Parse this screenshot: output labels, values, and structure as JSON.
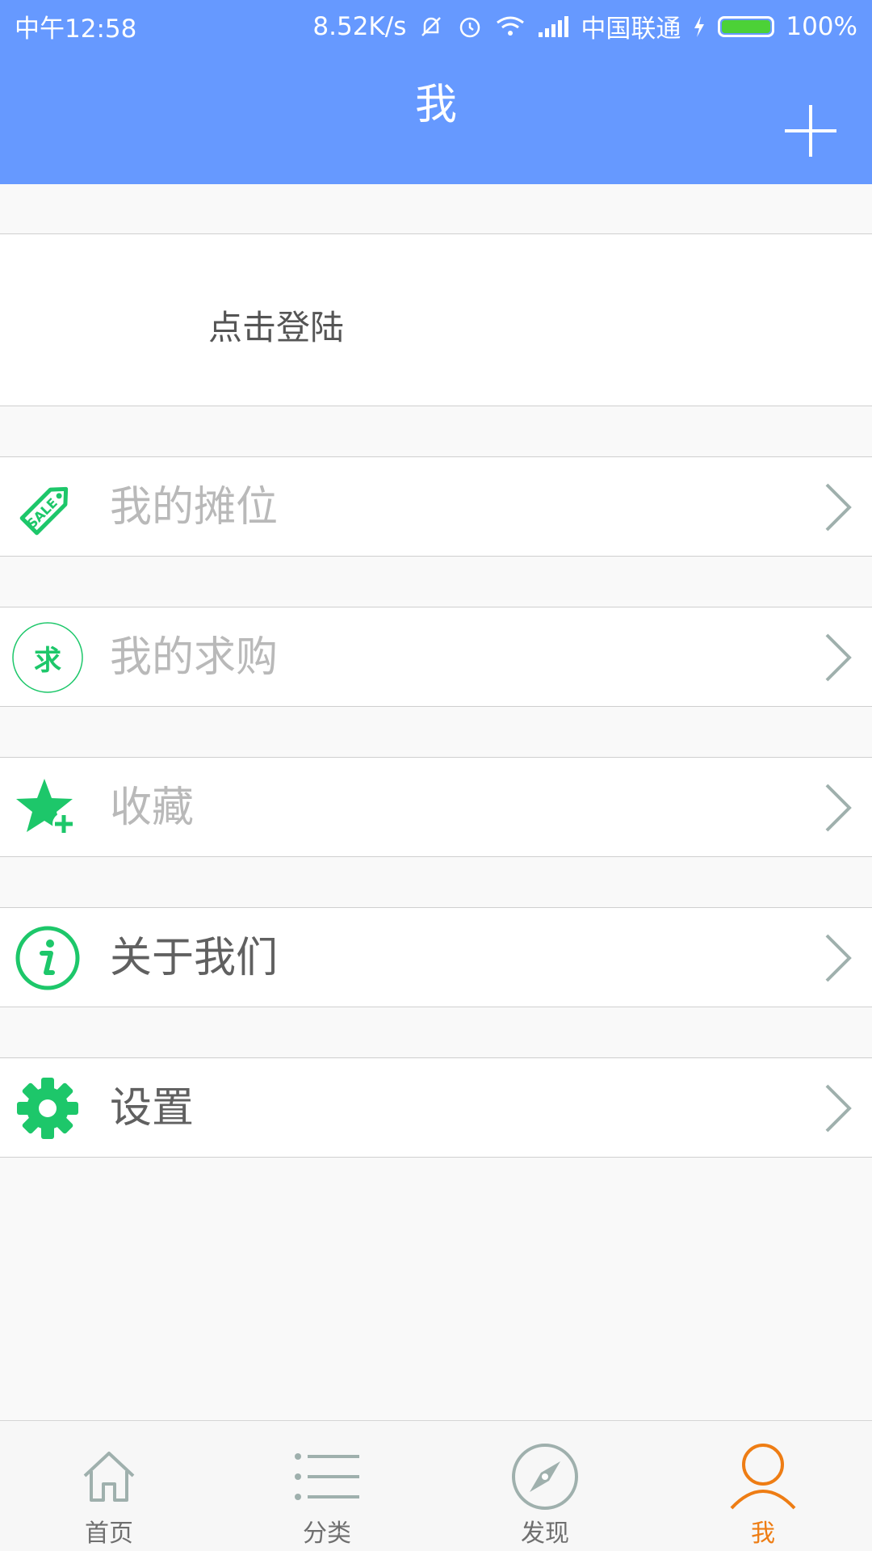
{
  "status_bar": {
    "time": "中午12:58",
    "speed": "8.52K/s",
    "carrier": "中国联通",
    "battery": "100%",
    "battery_level": 1.0,
    "icons": [
      "mute-icon",
      "alarm-icon",
      "wifi-icon",
      "signal-icon",
      "charging-icon",
      "battery-icon"
    ]
  },
  "header": {
    "title": "我",
    "action_icon": "plus-icon"
  },
  "login": {
    "text": "点击登陆"
  },
  "menu": [
    {
      "label": "我的摊位",
      "icon": "sale-tag-icon"
    },
    {
      "label": "我的求购",
      "icon": "qiu-badge-icon",
      "icon_text": "求"
    },
    {
      "label": "收藏",
      "icon": "star-plus-icon"
    },
    {
      "label": "关于我们",
      "icon": "info-icon"
    },
    {
      "label": "设置",
      "icon": "gear-icon"
    }
  ],
  "bottom_nav": [
    {
      "label": "首页",
      "icon": "home-icon"
    },
    {
      "label": "分类",
      "icon": "list-icon"
    },
    {
      "label": "发现",
      "icon": "compass-icon"
    },
    {
      "label": "我",
      "icon": "person-icon",
      "active": true
    }
  ],
  "colors": {
    "header_bg": "#6699ff",
    "accent_green": "#1dc76a",
    "active_nav": "#ee7d14",
    "chevron": "#9fb0ad"
  }
}
